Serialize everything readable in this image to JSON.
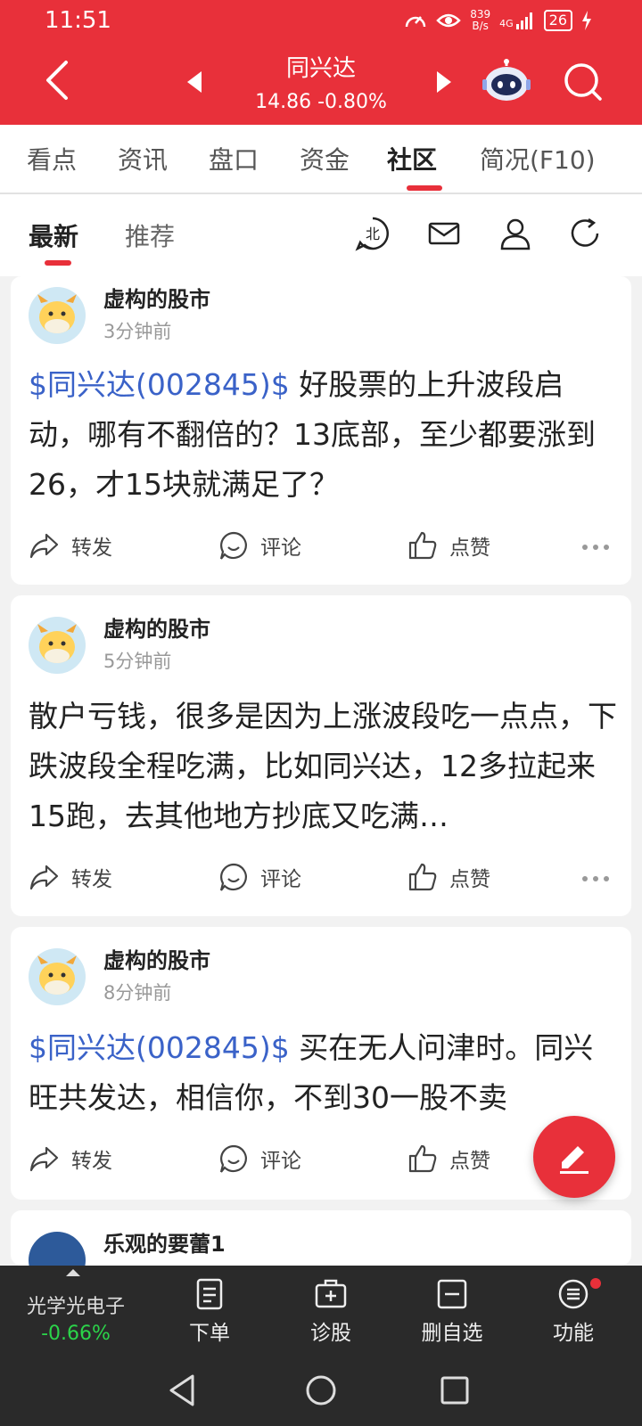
{
  "status_bar": {
    "time": "11:51",
    "speed_value": "839",
    "speed_unit": "B/s",
    "network": "4G",
    "battery": "26"
  },
  "header": {
    "stock_name": "同兴达",
    "price": "14.86",
    "change": "-0.80%"
  },
  "main_tabs": [
    {
      "label": "看点"
    },
    {
      "label": "资讯"
    },
    {
      "label": "盘口"
    },
    {
      "label": "资金"
    },
    {
      "label": "社区"
    },
    {
      "label": "简况(F10)"
    }
  ],
  "main_tab_active": "社区",
  "sub_tabs": [
    {
      "label": "最新"
    },
    {
      "label": "推荐"
    }
  ],
  "sub_tab_active": "最新",
  "posts": [
    {
      "author": "虚构的股市",
      "time": "3分钟前",
      "stock_link": "$同兴达(002845)$",
      "text": " 好股票的上升波段启动，哪有不翻倍的？13底部，至少都要涨到26，才15块就满足了？"
    },
    {
      "author": "虚构的股市",
      "time": "5分钟前",
      "stock_link": "",
      "text": "散户亏钱，很多是因为上涨波段吃一点点，下跌波段全程吃满，比如同兴达，12多拉起来15跑，去其他地方抄底又吃满…"
    },
    {
      "author": "虚构的股市",
      "time": "8分钟前",
      "stock_link": "$同兴达(002845)$",
      "text": " 买在无人问津时。同兴旺共发达，相信你，不到30一股不卖"
    },
    {
      "author": "乐观的要蕾1",
      "time": "",
      "stock_link": "",
      "text": ""
    }
  ],
  "actions": {
    "forward": "转发",
    "comment": "评论",
    "like": "点赞"
  },
  "bottom_bar": {
    "stock_name": "光学光电子",
    "stock_change": "-0.66%",
    "items": [
      {
        "label": "下单"
      },
      {
        "label": "诊股"
      },
      {
        "label": "删自选"
      },
      {
        "label": "功能"
      }
    ]
  },
  "colors": {
    "brand_red": "#e8303a",
    "link_blue": "#3a62c8",
    "down_green": "#2bd44a"
  }
}
